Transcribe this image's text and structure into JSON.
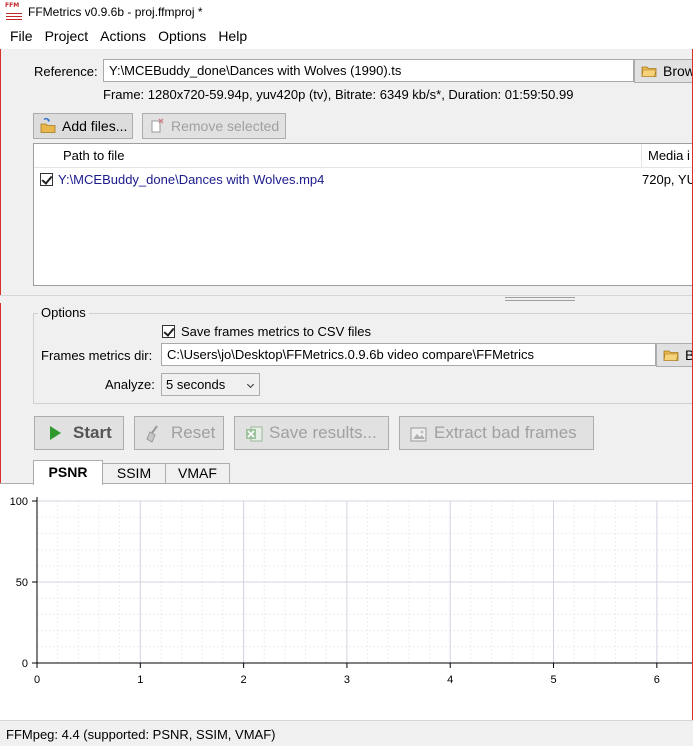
{
  "window": {
    "title": "FFMetrics v0.9.6b - proj.ffmproj *",
    "icon_label": "FFM"
  },
  "menu": [
    "File",
    "Project",
    "Actions",
    "Options",
    "Help"
  ],
  "reference": {
    "label": "Reference:",
    "path": "Y:\\MCEBuddy_done\\Dances with Wolves (1990).ts",
    "browse_label": "Brow",
    "info": "Frame: 1280x720-59.94p, yuv420p (tv), Bitrate: 6349 kb/s*, Duration: 01:59:50.99"
  },
  "file_buttons": {
    "add": "Add files...",
    "remove": "Remove selected"
  },
  "file_list": {
    "columns": [
      "Path to file",
      "Media i"
    ],
    "rows": [
      {
        "checked": true,
        "path": "Y:\\MCEBuddy_done\\Dances with Wolves.mp4",
        "media": "720p, YU"
      }
    ]
  },
  "options": {
    "group_title": "Options",
    "save_csv_label": "Save frames metrics to CSV files",
    "save_csv_checked": true,
    "dir_label": "Frames metrics dir:",
    "dir_value": "C:\\Users\\jo\\Desktop\\FFMetrics.0.9.6b video compare\\FFMetrics",
    "dir_browse_label": "B",
    "analyze_label": "Analyze:",
    "analyze_value": "5 seconds"
  },
  "actions": {
    "start": "Start",
    "reset": "Reset",
    "save": "Save results...",
    "extract": "Extract bad frames"
  },
  "tabs": [
    {
      "label": "PSNR",
      "active": true
    },
    {
      "label": "SSIM",
      "active": false
    },
    {
      "label": "VMAF",
      "active": false
    }
  ],
  "chart_data": {
    "type": "line",
    "title": "",
    "xlabel": "",
    "ylabel": "",
    "xlim": [
      0,
      6.35
    ],
    "ylim": [
      0,
      100
    ],
    "x_ticks": [
      0,
      1,
      2,
      3,
      4,
      5,
      6
    ],
    "y_ticks": [
      0,
      50,
      100
    ],
    "grid": true,
    "series": []
  },
  "status": {
    "text": "FFMpeg: 4.4 (supported: PSNR, SSIM, VMAF)"
  },
  "colors": {
    "accent_red": "#c0282b",
    "link_blue": "#1a1a8c",
    "start_green": "#2e9a2e"
  }
}
